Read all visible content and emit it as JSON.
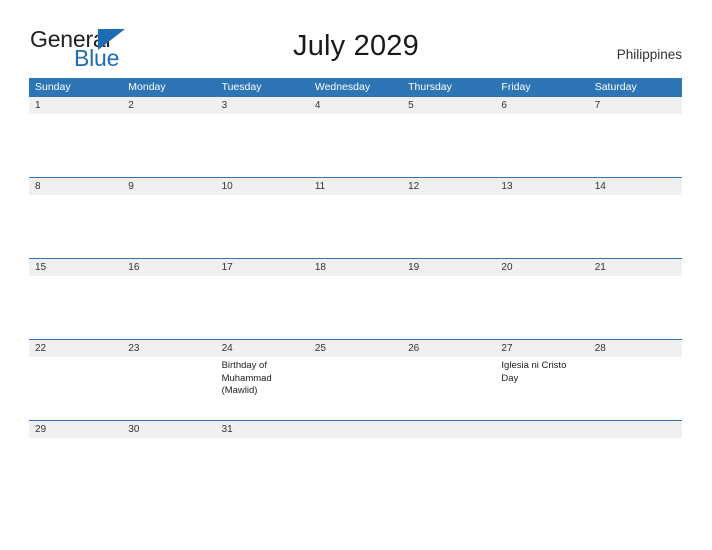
{
  "brand": {
    "name_part1": "General",
    "name_part2": "Blue",
    "flag_icon": "triangle-flag-icon",
    "accent_color": "#1c6cb3",
    "text_color": "#231f20"
  },
  "header": {
    "title": "July 2029",
    "country": "Philippines"
  },
  "calendar": {
    "header_bg": "#2e75b6",
    "header_text_color": "#ffffff",
    "band_bg": "#f0f0f0",
    "separator_color": "#2e75b6",
    "weekdays": [
      "Sunday",
      "Monday",
      "Tuesday",
      "Wednesday",
      "Thursday",
      "Friday",
      "Saturday"
    ],
    "weeks": [
      {
        "days": [
          {
            "date": "1",
            "events": []
          },
          {
            "date": "2",
            "events": []
          },
          {
            "date": "3",
            "events": []
          },
          {
            "date": "4",
            "events": []
          },
          {
            "date": "5",
            "events": []
          },
          {
            "date": "6",
            "events": []
          },
          {
            "date": "7",
            "events": []
          }
        ]
      },
      {
        "days": [
          {
            "date": "8",
            "events": []
          },
          {
            "date": "9",
            "events": []
          },
          {
            "date": "10",
            "events": []
          },
          {
            "date": "11",
            "events": []
          },
          {
            "date": "12",
            "events": []
          },
          {
            "date": "13",
            "events": []
          },
          {
            "date": "14",
            "events": []
          }
        ]
      },
      {
        "days": [
          {
            "date": "15",
            "events": []
          },
          {
            "date": "16",
            "events": []
          },
          {
            "date": "17",
            "events": []
          },
          {
            "date": "18",
            "events": []
          },
          {
            "date": "19",
            "events": []
          },
          {
            "date": "20",
            "events": []
          },
          {
            "date": "21",
            "events": []
          }
        ]
      },
      {
        "days": [
          {
            "date": "22",
            "events": []
          },
          {
            "date": "23",
            "events": []
          },
          {
            "date": "24",
            "events": [
              "Birthday of Muhammad (Mawlid)"
            ]
          },
          {
            "date": "25",
            "events": []
          },
          {
            "date": "26",
            "events": []
          },
          {
            "date": "27",
            "events": [
              "Iglesia ni Cristo Day"
            ]
          },
          {
            "date": "28",
            "events": []
          }
        ]
      },
      {
        "days": [
          {
            "date": "29",
            "events": []
          },
          {
            "date": "30",
            "events": []
          },
          {
            "date": "31",
            "events": []
          },
          {
            "date": "",
            "events": []
          },
          {
            "date": "",
            "events": []
          },
          {
            "date": "",
            "events": []
          },
          {
            "date": "",
            "events": []
          }
        ]
      }
    ]
  }
}
